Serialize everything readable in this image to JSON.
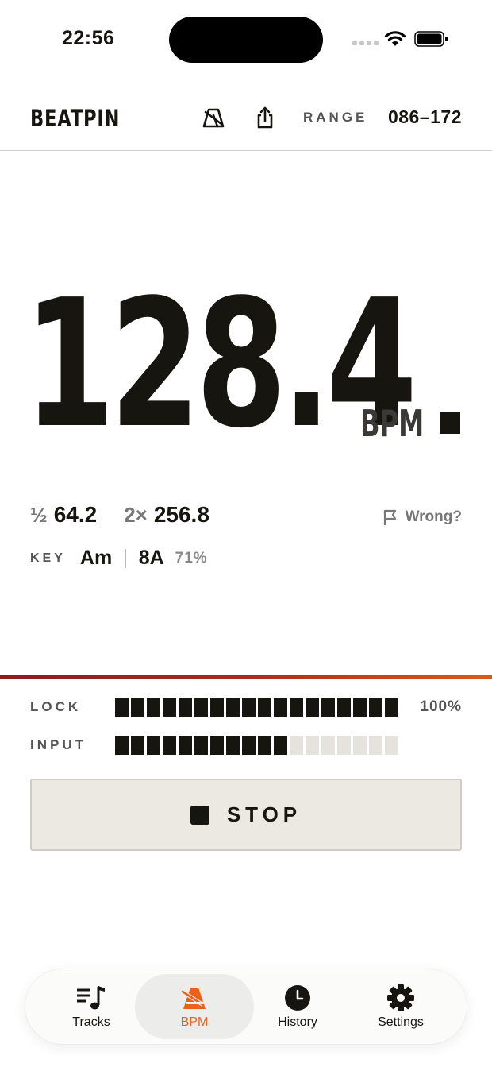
{
  "status_bar": {
    "time": "22:56"
  },
  "header": {
    "brand": "BEATPIN",
    "range_label": "RANGE",
    "range_value": "086–172"
  },
  "bpm": {
    "value": "128.4",
    "unit": "BPM"
  },
  "subdivisions": {
    "half_prefix": "½",
    "half_value": "64.2",
    "double_prefix": "2×",
    "double_value": "256.8",
    "wrong_label": "Wrong?"
  },
  "key": {
    "label": "KEY",
    "value": "Am",
    "camelot": "8A",
    "confidence": "71%"
  },
  "meters": {
    "lock": {
      "label": "LOCK",
      "level": 1.0,
      "percent": "100%"
    },
    "input": {
      "label": "INPUT",
      "level": 0.62
    }
  },
  "stop_button": {
    "label": "STOP"
  },
  "tabs": [
    {
      "label": "Tracks",
      "icon": "music-list-icon",
      "active": false
    },
    {
      "label": "BPM",
      "icon": "metronome-icon",
      "active": true
    },
    {
      "label": "History",
      "icon": "clock-icon",
      "active": false
    },
    {
      "label": "Settings",
      "icon": "gear-icon",
      "active": false
    }
  ],
  "colors": {
    "accent": "#e8621c",
    "ink": "#17150f",
    "button_bg": "#ece8e2"
  }
}
